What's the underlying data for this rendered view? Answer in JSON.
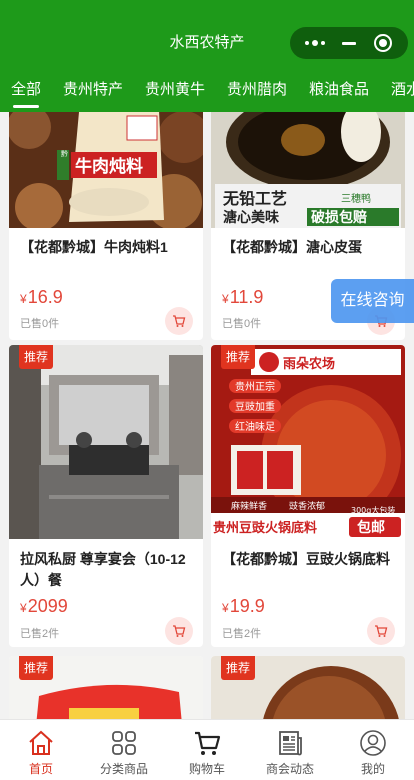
{
  "app": {
    "title": "水西农特产"
  },
  "capsule": {
    "more_icon": "more-dots-icon",
    "minimize_icon": "minus-icon",
    "close_icon": "target-circle-icon"
  },
  "category_tabs": [
    {
      "label": "全部",
      "active": true
    },
    {
      "label": "贵州特产"
    },
    {
      "label": "贵州黄牛"
    },
    {
      "label": "贵州腊肉"
    },
    {
      "label": "粮油食品"
    },
    {
      "label": "酒水"
    }
  ],
  "products": [
    {
      "name": "【花都黔城】牛肉炖料1",
      "price": "16.9",
      "currency": "¥",
      "sold": "已售0件",
      "badge": "",
      "image_text": [
        "牛肉炖料",
        "黔乡特产"
      ]
    },
    {
      "name": "【花都黔城】溏心皮蛋",
      "price": "11.9",
      "currency": "¥",
      "sold": "已售0件",
      "badge": "",
      "image_text": [
        "无铅工艺",
        "溏心美味",
        "破损包赔",
        "三穗鸭"
      ]
    },
    {
      "name": "拉风私厨 尊享宴会（10-12人）餐",
      "price": "2099",
      "currency": "¥",
      "sold": "已售2件",
      "badge": "推荐",
      "image_text": []
    },
    {
      "name": "【花都黔城】豆豉火锅底料",
      "price": "19.9",
      "currency": "¥",
      "sold": "已售2件",
      "badge": "推荐",
      "image_text": [
        "雨朵农场",
        "贵州正宗",
        "豆豉加重",
        "红油味足",
        "麻辣鲜香",
        "豉香浓郁",
        "贵州豆豉火锅底料",
        "300g大包装",
        "包邮"
      ]
    },
    {
      "name": "",
      "price": "",
      "currency": "",
      "sold": "",
      "badge": "推荐",
      "image_text": []
    },
    {
      "name": "",
      "price": "",
      "currency": "",
      "sold": "",
      "badge": "推荐",
      "image_text": []
    }
  ],
  "floating": {
    "consult_label": "在线咨询"
  },
  "tabbar": [
    {
      "label": "首页",
      "icon": "home-icon",
      "active": true
    },
    {
      "label": "分类商品",
      "icon": "grid-icon"
    },
    {
      "label": "购物车",
      "icon": "cart-icon"
    },
    {
      "label": "商会动态",
      "icon": "newspaper-icon"
    },
    {
      "label": "我的",
      "icon": "user-icon"
    }
  ],
  "colors": {
    "brand_green": "#1e9a1a",
    "price_red": "#e2473a",
    "active_red": "#d9301e",
    "consult_blue": "#4f97f0"
  }
}
